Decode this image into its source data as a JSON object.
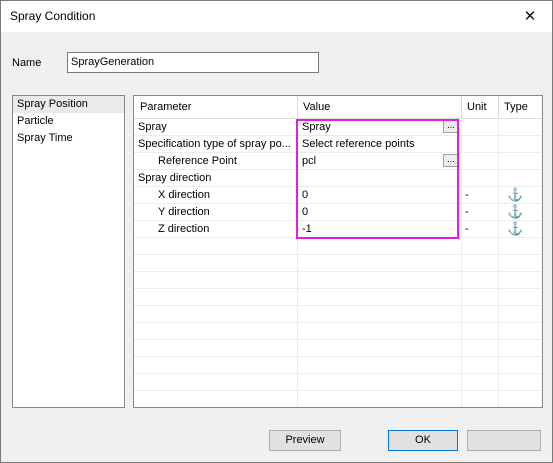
{
  "window": {
    "title": "Spray Condition",
    "close_glyph": "✕"
  },
  "name_field": {
    "label": "Name",
    "value": "SprayGeneration"
  },
  "left_list": [
    "Spray Position",
    "Particle",
    "Spray Time"
  ],
  "grid": {
    "headers": {
      "parameter": "Parameter",
      "value": "Value",
      "unit": "Unit",
      "type": "Type"
    },
    "rows": [
      {
        "param": "Spray",
        "indent": false,
        "value": "Spray",
        "ellipsis": "...",
        "unit": "",
        "type_icon": ""
      },
      {
        "param": "Specification type of spray po...",
        "indent": false,
        "value": "Select reference points",
        "unit": "",
        "type_icon": ""
      },
      {
        "param": "Reference Point",
        "indent": true,
        "value": "pcl",
        "ellipsis": "...",
        "unit": "",
        "type_icon": ""
      },
      {
        "param": "Spray direction",
        "indent": false,
        "value": "",
        "unit": "",
        "type_icon": ""
      },
      {
        "param": "X direction",
        "indent": true,
        "value": "0",
        "unit": "-",
        "type_icon": "anchor-icon"
      },
      {
        "param": "Y direction",
        "indent": true,
        "value": "0",
        "unit": "-",
        "type_icon": "anchor-icon"
      },
      {
        "param": "Z direction",
        "indent": true,
        "value": "-1",
        "unit": "-",
        "type_icon": "anchor-icon"
      }
    ]
  },
  "buttons": {
    "preview": "Preview",
    "ok": "OK",
    "cancel": ""
  },
  "colors": {
    "highlight": "#e020e0",
    "anchor": "#1a6fd8",
    "default_button_border": "#0078d7"
  }
}
